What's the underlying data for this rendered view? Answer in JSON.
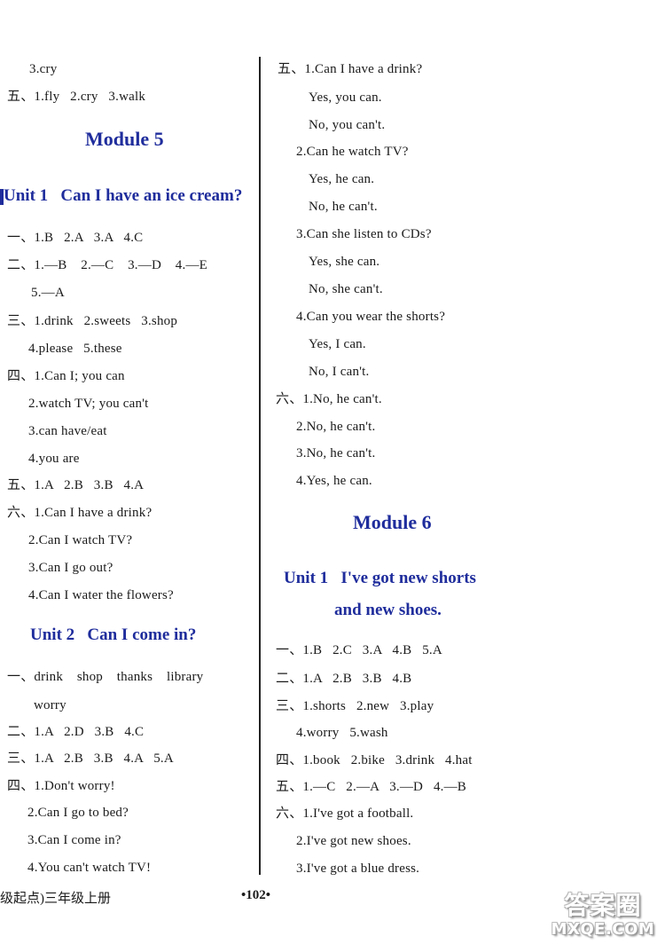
{
  "left_column": {
    "top_lines": [
      "3.cry",
      "五、1.fly   2.cry   3.walk"
    ],
    "module_title": "Module 5",
    "unit1_title": "Unit 1   Can I have an ice cream?",
    "unit1_lines": [
      "一、1.B   2.A   3.A   4.C",
      "二、1.—B    2.—C    3.—D    4.—E",
      "5.—A",
      "三、1.drink   2.sweets   3.shop",
      "4.please   5.these",
      "四、1.Can I; you can",
      "2.watch TV; you can't",
      "3.can have/eat",
      "4.you are",
      "五、1.A   2.B   3.B   4.A",
      "六、1.Can I have a drink?",
      "2.Can I watch TV?",
      "3.Can I go out?",
      "4.Can I water the flowers?"
    ],
    "unit2_title": "Unit 2   Can I come in?",
    "unit2_lines": [
      "一、drink    shop    thanks    library",
      "worry",
      "二、1.A   2.D   3.B   4.C",
      "三、1.A   2.B   3.B   4.A   5.A",
      "四、1.Don't worry!",
      "2.Can I go to bed?",
      "3.Can I come in?",
      "4.You can't watch TV!"
    ]
  },
  "right_column": {
    "lines": [
      "五、1.Can I have a drink?",
      "Yes, you can.",
      "No, you can't.",
      "2.Can he watch TV?",
      "Yes, he can.",
      "No, he can't.",
      "3.Can she listen to CDs?",
      "Yes, she can.",
      "No, she can't.",
      "4.Can you wear the shorts?",
      "Yes, I can.",
      "No, I can't.",
      "六、1.No, he can't.",
      "2.No, he can't.",
      "3.No, he can't.",
      "4.Yes, he can."
    ],
    "module_title": "Module 6",
    "unit1_title_line1": "Unit 1   I've got new shorts",
    "unit1_title_line2": "and new shoes.",
    "unit1_lines": [
      "一、1.B   2.C   3.A   4.B   5.A",
      "二、1.A   2.B   3.B   4.B",
      "三、1.shorts   2.new   3.play",
      "4.worry   5.wash",
      "四、1.book   2.bike   3.drink   4.hat",
      "五、1.—C   2.—A   3.—D   4.—B",
      "六、1.I've got a football.",
      "2.I've got new shoes.",
      "3.I've got a blue dress."
    ]
  },
  "footer": {
    "book_label": "级起点)三年级上册",
    "page_number": "•102•"
  },
  "watermark": {
    "chinese": "答案圈",
    "domain": "MXQE.COM"
  },
  "colors": {
    "heading_blue": "#1f2d9c",
    "text": "#1a1a1a",
    "divider": "#222222"
  }
}
